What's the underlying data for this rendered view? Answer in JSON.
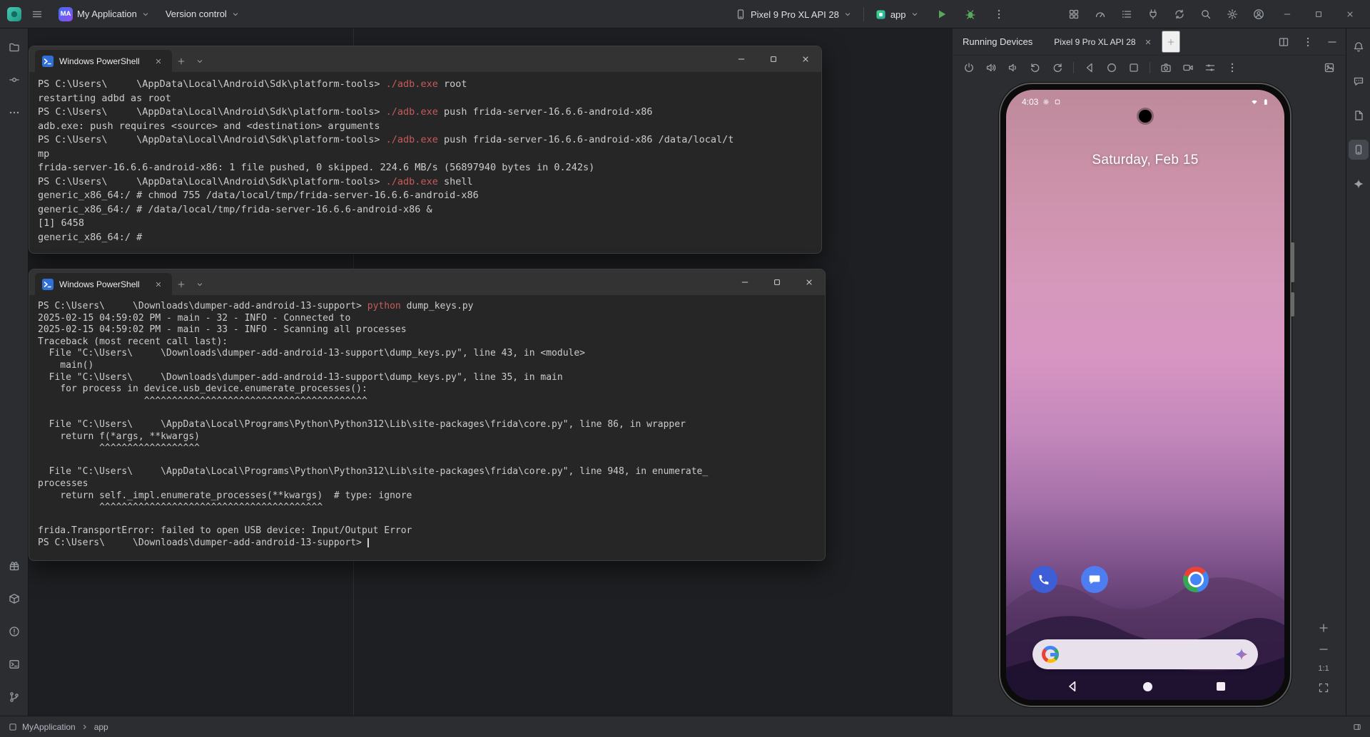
{
  "topbar": {
    "project_badge": "MA",
    "project_name": "My Application",
    "version_control_label": "Version control",
    "device_name": "Pixel 9 Pro XL API 28",
    "run_config": "app"
  },
  "terminal1": {
    "title": "Windows PowerShell",
    "lines": [
      [
        [
          "PS C:\\Users\\     \\AppData\\Local\\Android\\Sdk\\platform-tools> ",
          ""
        ],
        [
          "./adb.exe",
          "cmd"
        ],
        [
          " root",
          ""
        ]
      ],
      [
        [
          "restarting adbd as root",
          ""
        ]
      ],
      [
        [
          "PS C:\\Users\\     \\AppData\\Local\\Android\\Sdk\\platform-tools> ",
          ""
        ],
        [
          "./adb.exe",
          "cmd"
        ],
        [
          " push frida-server-16.6.6-android-x86",
          ""
        ]
      ],
      [
        [
          "adb.exe: push requires <source> and <destination> arguments",
          ""
        ]
      ],
      [
        [
          "PS C:\\Users\\     \\AppData\\Local\\Android\\Sdk\\platform-tools> ",
          ""
        ],
        [
          "./adb.exe",
          "cmd"
        ],
        [
          " push frida-server-16.6.6-android-x86 /data/local/t",
          ""
        ]
      ],
      [
        [
          "mp",
          ""
        ]
      ],
      [
        [
          "frida-server-16.6.6-android-x86: 1 file pushed, 0 skipped. 224.6 MB/s (56897940 bytes in 0.242s)",
          ""
        ]
      ],
      [
        [
          "PS C:\\Users\\     \\AppData\\Local\\Android\\Sdk\\platform-tools> ",
          ""
        ],
        [
          "./adb.exe",
          "cmd"
        ],
        [
          " shell",
          ""
        ]
      ],
      [
        [
          "generic_x86_64:/ # chmod 755 /data/local/tmp/frida-server-16.6.6-android-x86",
          ""
        ]
      ],
      [
        [
          "generic_x86_64:/ # /data/local/tmp/frida-server-16.6.6-android-x86 &",
          ""
        ]
      ],
      [
        [
          "[1] 6458",
          ""
        ]
      ],
      [
        [
          "generic_x86_64:/ #",
          ""
        ]
      ]
    ]
  },
  "terminal2": {
    "title": "Windows PowerShell",
    "lines": [
      [
        [
          "PS C:\\Users\\     \\Downloads\\dumper-add-android-13-support> ",
          ""
        ],
        [
          "python",
          "cmd"
        ],
        [
          " dump_keys.py",
          ""
        ]
      ],
      [
        [
          "2025-02-15 04:59:02 PM - main - 32 - INFO - Connected to",
          ""
        ]
      ],
      [
        [
          "2025-02-15 04:59:02 PM - main - 33 - INFO - Scanning all processes",
          ""
        ]
      ],
      [
        [
          "Traceback (most recent call last):",
          ""
        ]
      ],
      [
        [
          "  File \"C:\\Users\\     \\Downloads\\dumper-add-android-13-support\\dump_keys.py\", line 43, in <module>",
          ""
        ]
      ],
      [
        [
          "    main()",
          ""
        ]
      ],
      [
        [
          "  File \"C:\\Users\\     \\Downloads\\dumper-add-android-13-support\\dump_keys.py\", line 35, in main",
          ""
        ]
      ],
      [
        [
          "    for process in device.usb_device.enumerate_processes():",
          ""
        ]
      ],
      [
        [
          "                   ^^^^^^^^^^^^^^^^^^^^^^^^^^^^^^^^^^^^^^^^",
          ""
        ]
      ],
      [],
      [
        [
          "  File \"C:\\Users\\     \\AppData\\Local\\Programs\\Python\\Python312\\Lib\\site-packages\\frida\\core.py\", line 86, in wrapper",
          ""
        ]
      ],
      [
        [
          "    return f(*args, **kwargs)",
          ""
        ]
      ],
      [
        [
          "           ^^^^^^^^^^^^^^^^^^",
          ""
        ]
      ],
      [],
      [
        [
          "  File \"C:\\Users\\     \\AppData\\Local\\Programs\\Python\\Python312\\Lib\\site-packages\\frida\\core.py\", line 948, in enumerate_",
          ""
        ]
      ],
      [
        [
          "processes",
          ""
        ]
      ],
      [
        [
          "    return self._impl.enumerate_processes(**kwargs)  # type: ignore",
          ""
        ]
      ],
      [
        [
          "           ^^^^^^^^^^^^^^^^^^^^^^^^^^^^^^^^^^^^^^^^",
          ""
        ]
      ],
      [],
      [
        [
          "frida.TransportError: failed to open USB device: Input/Output Error",
          ""
        ]
      ],
      [
        [
          "PS C:\\Users\\     \\Downloads\\dumper-add-android-13-support> ",
          ""
        ],
        [
          "",
          "cursor"
        ]
      ]
    ]
  },
  "running_devices": {
    "panel_title": "Running Devices",
    "tab_title": "Pixel 9 Pro XL API 28",
    "zoom_reset": "1:1"
  },
  "phone": {
    "time": "4:03",
    "date": "Saturday, Feb 15"
  },
  "statusbar": {
    "project": "MyApplication",
    "module": "app"
  },
  "colors": {
    "command_red": "#c75b5b",
    "run_green": "#57a85c",
    "accent_blue": "#3574f0",
    "terminal_bg": "#262626",
    "panel_bg": "#2b2d30"
  }
}
